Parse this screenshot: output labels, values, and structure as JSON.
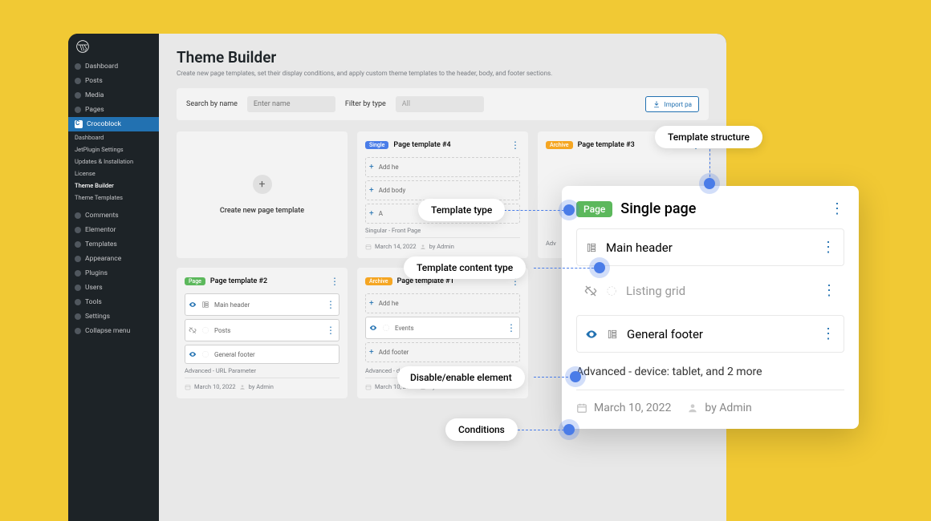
{
  "sidebar": {
    "items": [
      "Dashboard",
      "Posts",
      "Media",
      "Pages"
    ],
    "active": "Crocoblock",
    "sub": [
      "Dashboard",
      "JetPlugin Settings",
      "Updates & Installation",
      "License",
      "Theme Builder",
      "Theme Templates"
    ],
    "sub_active_index": 4,
    "items2": [
      "Comments",
      "Elementor",
      "Templates",
      "Appearance",
      "Plugins",
      "Users",
      "Tools",
      "Settings",
      "Collapse menu"
    ]
  },
  "page": {
    "title": "Theme Builder",
    "desc": "Create new page templates, set their display conditions, and apply custom theme templates to the header, body, and footer sections."
  },
  "filters": {
    "search_label": "Search by name",
    "search_placeholder": "Enter name",
    "filter_label": "Filter by type",
    "filter_value": "All",
    "import_label": "Import pa"
  },
  "create_card": "Create new page template",
  "cards": [
    {
      "badge": "Single",
      "badge_class": "single",
      "title": "Page template #4",
      "rows": [
        {
          "t": "add",
          "label": "Add he"
        },
        {
          "t": "add",
          "label": "Add body"
        },
        {
          "t": "add",
          "label": "A"
        }
      ],
      "cond": "Singular - Front Page",
      "date": "March 14, 2022",
      "author": "by Admin"
    },
    {
      "badge": "Archive",
      "badge_class": "archive",
      "title": "Page template #3",
      "rows": [],
      "cond": "Adv",
      "date": "",
      "author": ""
    },
    {
      "badge": "Page",
      "badge_class": "page",
      "title": "Page template #2",
      "rows": [
        {
          "t": "item",
          "label": "Main header",
          "eye": true
        },
        {
          "t": "item",
          "label": "Posts",
          "eye": false
        },
        {
          "t": "item",
          "label": "General footer",
          "eye": true
        }
      ],
      "cond": "Advanced - URL Parameter",
      "date": "March 10, 2022",
      "author": "by Admin"
    },
    {
      "badge": "Archive",
      "badge_class": "archive",
      "title": "Page template #1",
      "rows": [
        {
          "t": "add",
          "label": "Add he"
        },
        {
          "t": "item",
          "label": "Events",
          "eye": true
        },
        {
          "t": "add",
          "label": "Add footer"
        }
      ],
      "cond": "Advanced - device: tablet, and 2 more",
      "date": "March 10, 2022",
      "author": "by Admin"
    }
  ],
  "detail": {
    "badge": "Page",
    "title": "Single page",
    "rows": [
      {
        "label": "Main header",
        "state": "active"
      },
      {
        "label": "Listing grid",
        "state": "disabled"
      },
      {
        "label": "General footer",
        "state": "active"
      }
    ],
    "cond": "Advanced - device: tablet, and 2 more",
    "date": "March 10, 2022",
    "author": "by Admin"
  },
  "callouts": {
    "structure": "Template structure",
    "type": "Template type",
    "content": "Template content type",
    "toggle": "Disable/enable element",
    "conditions": "Conditions"
  }
}
